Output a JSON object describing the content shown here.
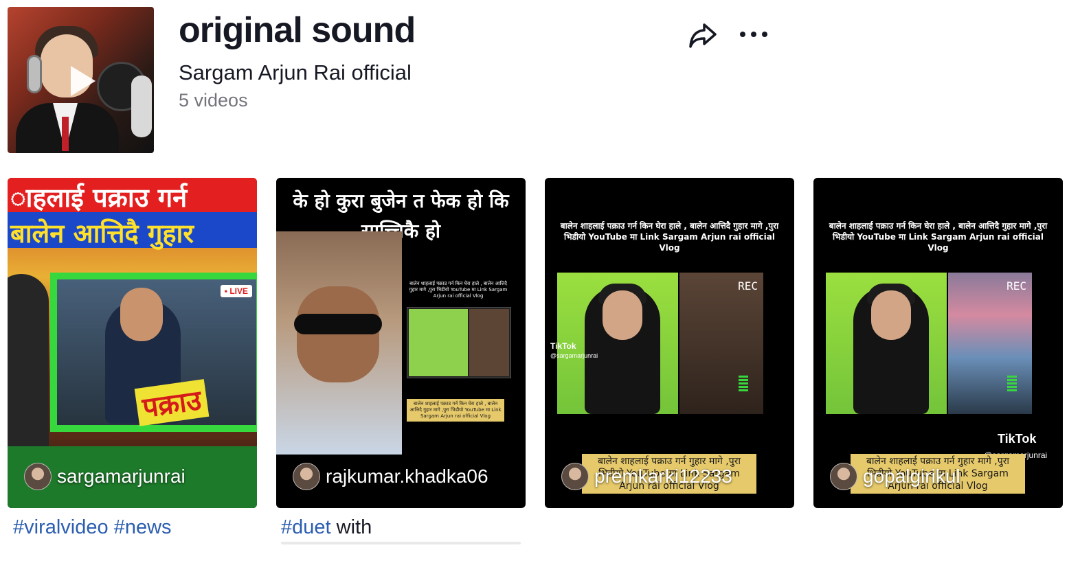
{
  "header": {
    "title": "original sound",
    "author": "Sargam Arjun Rai official",
    "video_count": "5 videos"
  },
  "icons": {
    "share": "share-icon",
    "more": "more-icon",
    "play": "play-icon"
  },
  "videos": [
    {
      "username": "sargamarjunrai",
      "thumb_headline_1": "ाहलाई पक्राउ गर्न",
      "thumb_headline_2": "बालेन आत्तिदै गुहार",
      "thumb_live": "• LIVE",
      "thumb_badge": "पक्राउ",
      "caption_tags": [
        "#viralvideo",
        "#news"
      ]
    },
    {
      "username": "rajkumar.khadka06",
      "thumb_headline": "के हो कुरा बुजेन त फेक हो कि साच्चिकै हो",
      "thumb_small": "बालेन शाहलाई पक्राउ गर्न किन घेरा हाले , बालेन आत्तिदै गुहार मागे ,पुरा भिडीयो YouTube मा Link Sargam Arjun rai official Vlog",
      "thumb_yellow": "बालेन शाहलाई पक्राउ गर्न किन घेरा हाले , बालेन आत्तिदै गुहार मागे ,पुरा भिडीयो YouTube मा Link Sargam Arjun rai official Vlog",
      "caption_tag": "#duet",
      "caption_text": " with"
    },
    {
      "username": "premkarki12233",
      "thumb_caption": "बालेन शाहलाई पक्राउ गर्न किन घेरा हाले , बालेन आत्तिदै गुहार मागे ,पुरा भिडीयो YouTube मा Link Sargam Arjun rai official Vlog",
      "thumb_rec": "REC",
      "thumb_tiktok": "TikTok",
      "thumb_handle": "@sargamarjunrai",
      "thumb_yellow": "बालेन शाहलाई पक्राउ गर्न गुहार मागे ,पुरा भिडीयो YouTube मा Link Sargam Arjun rai official Vlog"
    },
    {
      "username": "gopalgirikul",
      "thumb_caption": "बालेन शाहलाई पक्राउ गर्न किन घेरा हाले , बालेन आत्तिदै गुहार मागे ,पुरा भिडीयो YouTube मा Link Sargam Arjun rai official Vlog",
      "thumb_rec": "REC",
      "thumb_tiktok": "TikTok",
      "thumb_handle": "@sargamarjunrai",
      "thumb_yellow": "बालेन शाहलाई पक्राउ गर्न गुहार मागे ,पुरा भिडीयो YouTube मा Link Sargam Arjun rai official Vlog"
    }
  ]
}
